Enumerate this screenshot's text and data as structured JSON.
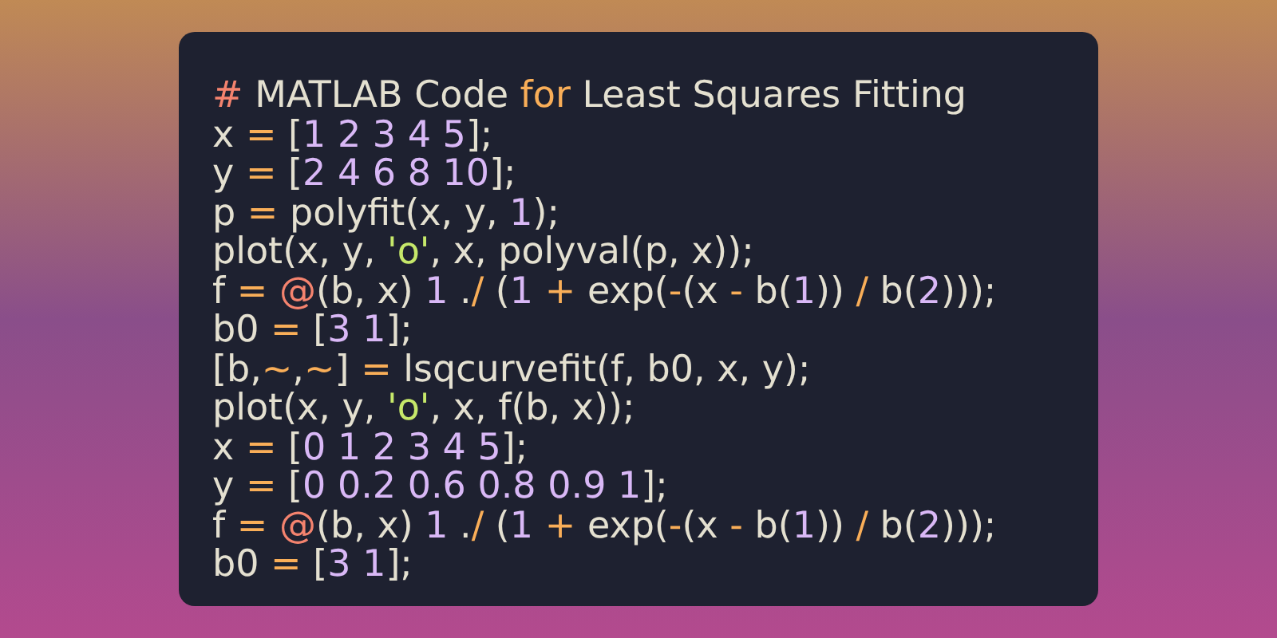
{
  "code_lines": [
    {
      "tokens": [
        {
          "kind": "special",
          "text": "#"
        },
        {
          "kind": "plain",
          "text": " MATLAB Code "
        },
        {
          "kind": "keyword",
          "text": "for"
        },
        {
          "kind": "plain",
          "text": " Least Squares Fitting"
        }
      ]
    },
    {
      "tokens": [
        {
          "kind": "plain",
          "text": "x "
        },
        {
          "kind": "operator",
          "text": "="
        },
        {
          "kind": "plain",
          "text": " ["
        },
        {
          "kind": "number",
          "text": "1 2 3 4 5"
        },
        {
          "kind": "plain",
          "text": "];"
        }
      ]
    },
    {
      "tokens": [
        {
          "kind": "plain",
          "text": "y "
        },
        {
          "kind": "operator",
          "text": "="
        },
        {
          "kind": "plain",
          "text": " ["
        },
        {
          "kind": "number",
          "text": "2 4 6 8 10"
        },
        {
          "kind": "plain",
          "text": "];"
        }
      ]
    },
    {
      "tokens": [
        {
          "kind": "plain",
          "text": "p "
        },
        {
          "kind": "operator",
          "text": "="
        },
        {
          "kind": "plain",
          "text": " polyfit(x, y, "
        },
        {
          "kind": "number",
          "text": "1"
        },
        {
          "kind": "plain",
          "text": ");"
        }
      ]
    },
    {
      "tokens": [
        {
          "kind": "plain",
          "text": "plot(x, y, "
        },
        {
          "kind": "string",
          "text": "'o'"
        },
        {
          "kind": "plain",
          "text": ", x, polyval(p, x));"
        }
      ]
    },
    {
      "tokens": [
        {
          "kind": "plain",
          "text": "f "
        },
        {
          "kind": "operator",
          "text": "="
        },
        {
          "kind": "special",
          "text": " @"
        },
        {
          "kind": "plain",
          "text": "(b, x) "
        },
        {
          "kind": "number",
          "text": "1"
        },
        {
          "kind": "plain",
          "text": " ."
        },
        {
          "kind": "operator",
          "text": "/"
        },
        {
          "kind": "plain",
          "text": " ("
        },
        {
          "kind": "number",
          "text": "1"
        },
        {
          "kind": "operator",
          "text": " +"
        },
        {
          "kind": "plain",
          "text": " exp("
        },
        {
          "kind": "operator",
          "text": "-"
        },
        {
          "kind": "plain",
          "text": "(x "
        },
        {
          "kind": "operator",
          "text": "-"
        },
        {
          "kind": "plain",
          "text": " b("
        },
        {
          "kind": "number",
          "text": "1"
        },
        {
          "kind": "plain",
          "text": ")) "
        },
        {
          "kind": "operator",
          "text": "/"
        },
        {
          "kind": "plain",
          "text": " b("
        },
        {
          "kind": "number",
          "text": "2"
        },
        {
          "kind": "plain",
          "text": ")));"
        }
      ]
    },
    {
      "tokens": [
        {
          "kind": "plain",
          "text": "b0 "
        },
        {
          "kind": "operator",
          "text": "="
        },
        {
          "kind": "plain",
          "text": " ["
        },
        {
          "kind": "number",
          "text": "3 1"
        },
        {
          "kind": "plain",
          "text": "];"
        }
      ]
    },
    {
      "tokens": [
        {
          "kind": "plain",
          "text": "[b,"
        },
        {
          "kind": "operator",
          "text": "~"
        },
        {
          "kind": "plain",
          "text": ","
        },
        {
          "kind": "operator",
          "text": "~"
        },
        {
          "kind": "plain",
          "text": "] "
        },
        {
          "kind": "operator",
          "text": "="
        },
        {
          "kind": "plain",
          "text": " lsqcurvefit(f, b0, x, y);"
        }
      ]
    },
    {
      "tokens": [
        {
          "kind": "plain",
          "text": "plot(x, y, "
        },
        {
          "kind": "string",
          "text": "'o'"
        },
        {
          "kind": "plain",
          "text": ", x, f(b, x));"
        }
      ]
    },
    {
      "tokens": [
        {
          "kind": "plain",
          "text": "x "
        },
        {
          "kind": "operator",
          "text": "="
        },
        {
          "kind": "plain",
          "text": " ["
        },
        {
          "kind": "number",
          "text": "0 1 2 3 4 5"
        },
        {
          "kind": "plain",
          "text": "];"
        }
      ]
    },
    {
      "tokens": [
        {
          "kind": "plain",
          "text": "y "
        },
        {
          "kind": "operator",
          "text": "="
        },
        {
          "kind": "plain",
          "text": " ["
        },
        {
          "kind": "number",
          "text": "0 0.2 0.6 0.8 0.9 1"
        },
        {
          "kind": "plain",
          "text": "];"
        }
      ]
    },
    {
      "tokens": [
        {
          "kind": "plain",
          "text": "f "
        },
        {
          "kind": "operator",
          "text": "="
        },
        {
          "kind": "special",
          "text": " @"
        },
        {
          "kind": "plain",
          "text": "(b, x) "
        },
        {
          "kind": "number",
          "text": "1"
        },
        {
          "kind": "plain",
          "text": " ."
        },
        {
          "kind": "operator",
          "text": "/"
        },
        {
          "kind": "plain",
          "text": " ("
        },
        {
          "kind": "number",
          "text": "1"
        },
        {
          "kind": "operator",
          "text": " +"
        },
        {
          "kind": "plain",
          "text": " exp("
        },
        {
          "kind": "operator",
          "text": "-"
        },
        {
          "kind": "plain",
          "text": "(x "
        },
        {
          "kind": "operator",
          "text": "-"
        },
        {
          "kind": "plain",
          "text": " b("
        },
        {
          "kind": "number",
          "text": "1"
        },
        {
          "kind": "plain",
          "text": ")) "
        },
        {
          "kind": "operator",
          "text": "/"
        },
        {
          "kind": "plain",
          "text": " b("
        },
        {
          "kind": "number",
          "text": "2"
        },
        {
          "kind": "plain",
          "text": ")));"
        }
      ]
    },
    {
      "tokens": [
        {
          "kind": "plain",
          "text": "b0 "
        },
        {
          "kind": "operator",
          "text": "="
        },
        {
          "kind": "plain",
          "text": " ["
        },
        {
          "kind": "number",
          "text": "3 1"
        },
        {
          "kind": "plain",
          "text": "];"
        }
      ]
    }
  ]
}
